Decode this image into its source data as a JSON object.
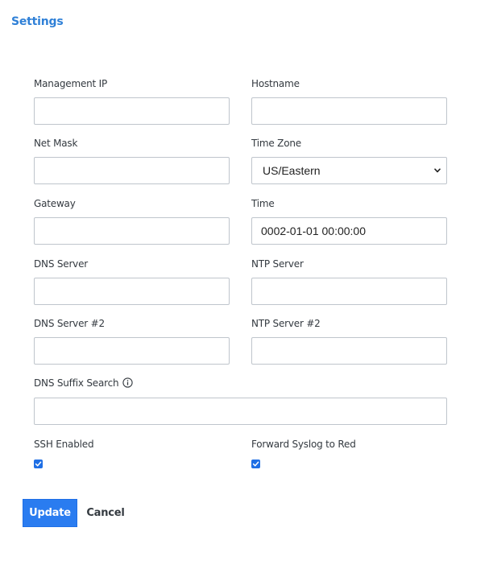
{
  "header": {
    "title": "Settings"
  },
  "fields": {
    "management_ip": {
      "label": "Management IP",
      "value": ""
    },
    "hostname": {
      "label": "Hostname",
      "value": ""
    },
    "net_mask": {
      "label": "Net Mask",
      "value": ""
    },
    "time_zone": {
      "label": "Time Zone",
      "selected": "US/Eastern"
    },
    "gateway": {
      "label": "Gateway",
      "value": ""
    },
    "time": {
      "label": "Time",
      "value": "0002-01-01 00:00:00"
    },
    "dns_server": {
      "label": "DNS Server",
      "value": ""
    },
    "ntp_server": {
      "label": "NTP Server",
      "value": ""
    },
    "dns_server_2": {
      "label": "DNS Server #2",
      "value": ""
    },
    "ntp_server_2": {
      "label": "NTP Server #2",
      "value": ""
    },
    "dns_suffix_search": {
      "label": "DNS Suffix Search",
      "value": "",
      "icon": "info-icon"
    },
    "ssh_enabled": {
      "label": "SSH Enabled",
      "checked": true
    },
    "forward_syslog": {
      "label": "Forward Syslog to Red",
      "checked": true
    }
  },
  "actions": {
    "update_label": "Update",
    "cancel_label": "Cancel"
  },
  "colors": {
    "accent": "#2a7cf0",
    "title": "#2f80d7",
    "checkbox": "#1f6fe5",
    "border": "#bfc5cc"
  }
}
